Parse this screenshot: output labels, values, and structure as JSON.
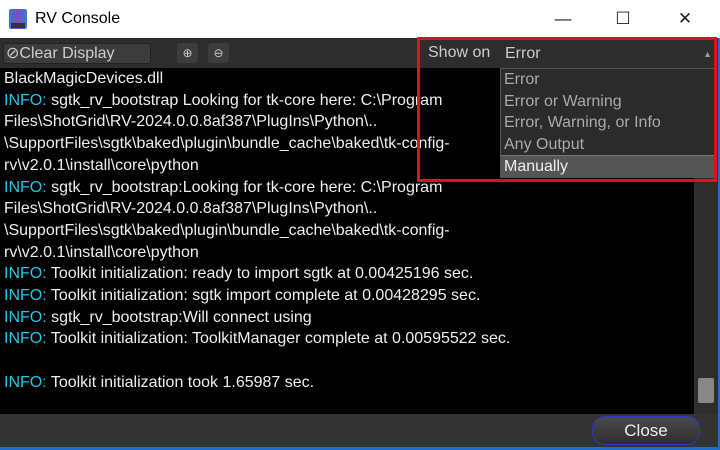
{
  "window": {
    "title": "RV Console",
    "minimize": "—",
    "maximize": "☐",
    "close": "✕"
  },
  "toolbar": {
    "clear_label": "Clear Display",
    "clear_icon": "⊘",
    "zoom_in": "⊕",
    "zoom_out": "⊖",
    "show_on_label": "Show on",
    "show_on_value": "Error"
  },
  "dropdown": {
    "options": [
      "Error",
      "Error or Warning",
      "Error, Warning, or Info",
      "Any Output",
      "Manually"
    ],
    "highlighted": "Manually"
  },
  "console": {
    "lines": [
      {
        "prefix": "",
        "text": "BlackMagicDevices.dll"
      },
      {
        "prefix": "INFO:",
        "text": " sgtk_rv_bootstrap Looking for tk-core here: C:\\Program"
      },
      {
        "prefix": "",
        "text": "Files\\ShotGrid\\RV-2024.0.0.8af387\\PlugIns\\Python\\.."
      },
      {
        "prefix": "",
        "text": "\\SupportFiles\\sgtk\\baked\\plugin\\bundle_cache\\baked\\tk-config-"
      },
      {
        "prefix": "",
        "text": "rv\\v2.0.1\\install\\core\\python"
      },
      {
        "prefix": "INFO:",
        "text": " sgtk_rv_bootstrap:Looking for tk-core here: C:\\Program"
      },
      {
        "prefix": "",
        "text": "Files\\ShotGrid\\RV-2024.0.0.8af387\\PlugIns\\Python\\.."
      },
      {
        "prefix": "",
        "text": "\\SupportFiles\\sgtk\\baked\\plugin\\bundle_cache\\baked\\tk-config-"
      },
      {
        "prefix": "",
        "text": "rv\\v2.0.1\\install\\core\\python"
      },
      {
        "prefix": "INFO:",
        "text": " Toolkit initialization: ready to import sgtk at 0.00425196 sec."
      },
      {
        "prefix": "INFO:",
        "text": " Toolkit initialization: sgtk import complete at 0.00428295 sec."
      },
      {
        "prefix": "INFO:",
        "text": " sgtk_rv_bootstrap:Will connect using"
      },
      {
        "prefix": "INFO:",
        "text": " Toolkit initialization: ToolkitManager complete at 0.00595522 sec."
      },
      {
        "prefix": "",
        "text": " "
      },
      {
        "prefix": "INFO:",
        "text": " Toolkit initialization took 1.65987 sec."
      }
    ]
  },
  "footer": {
    "close_label": "Close"
  }
}
